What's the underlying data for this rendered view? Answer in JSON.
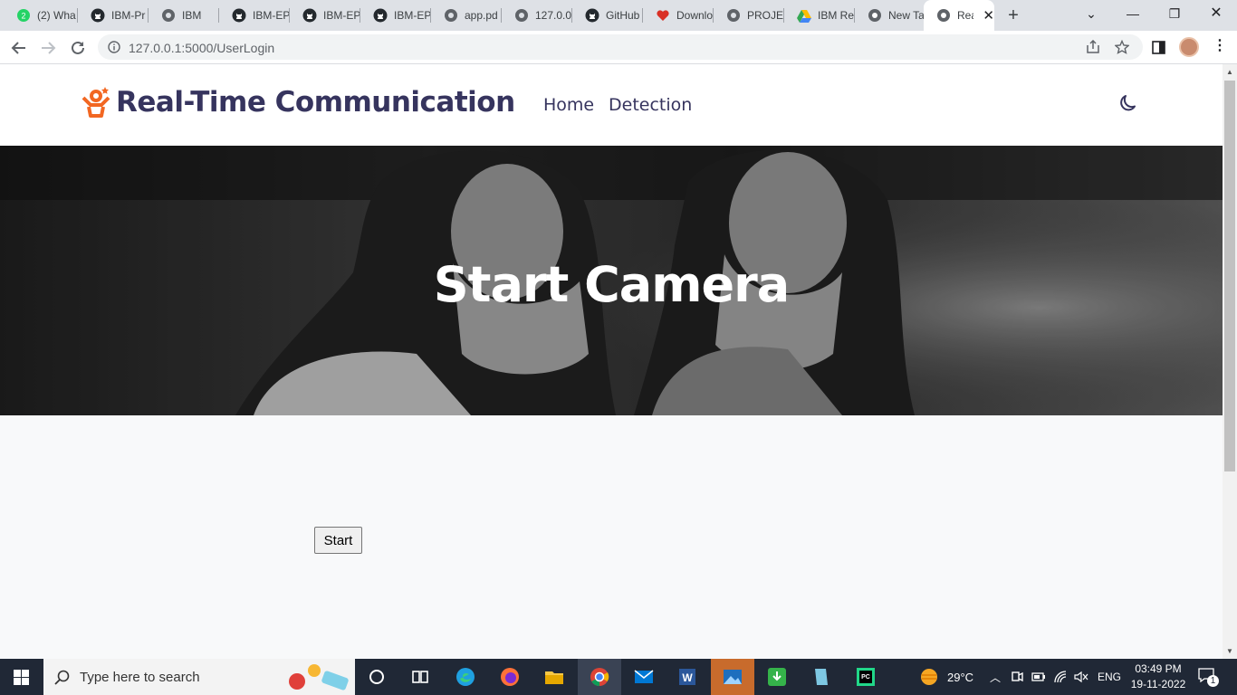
{
  "browser": {
    "tabs": [
      {
        "label": "(2) Wha",
        "icon": "whatsapp-icon",
        "badge": "2"
      },
      {
        "label": "IBM-Pr",
        "icon": "github-icon"
      },
      {
        "label": "IBM",
        "icon": "globe-icon"
      },
      {
        "label": "IBM-EP",
        "icon": "github-icon"
      },
      {
        "label": "IBM-EP",
        "icon": "github-icon"
      },
      {
        "label": "IBM-EP",
        "icon": "github-icon"
      },
      {
        "label": "app.pd",
        "icon": "globe-icon"
      },
      {
        "label": "127.0.0",
        "icon": "globe-icon"
      },
      {
        "label": "GitHub",
        "icon": "github-icon"
      },
      {
        "label": "Downlo",
        "icon": "heart-icon"
      },
      {
        "label": "PROJEC",
        "icon": "globe-icon"
      },
      {
        "label": "IBM Re",
        "icon": "google-drive-icon"
      },
      {
        "label": "New Ta",
        "icon": "chrome-icon"
      },
      {
        "label": "Rea",
        "icon": "globe-icon",
        "active": true
      }
    ],
    "url": "127.0.0.1:5000/UserLogin"
  },
  "site": {
    "brand": "Real-Time Communication",
    "nav": [
      "Home",
      "Detection"
    ],
    "hero_title": "Start Camera",
    "start_button": "Start"
  },
  "taskbar": {
    "search_placeholder": "Type here to search",
    "temperature": "29°C",
    "language": "ENG",
    "time": "03:49 PM",
    "date": "19-11-2022",
    "notification_count": "1"
  },
  "colors": {
    "brand_text": "#36345e",
    "brand_icon": "#f26722",
    "taskbar": "#202836"
  }
}
